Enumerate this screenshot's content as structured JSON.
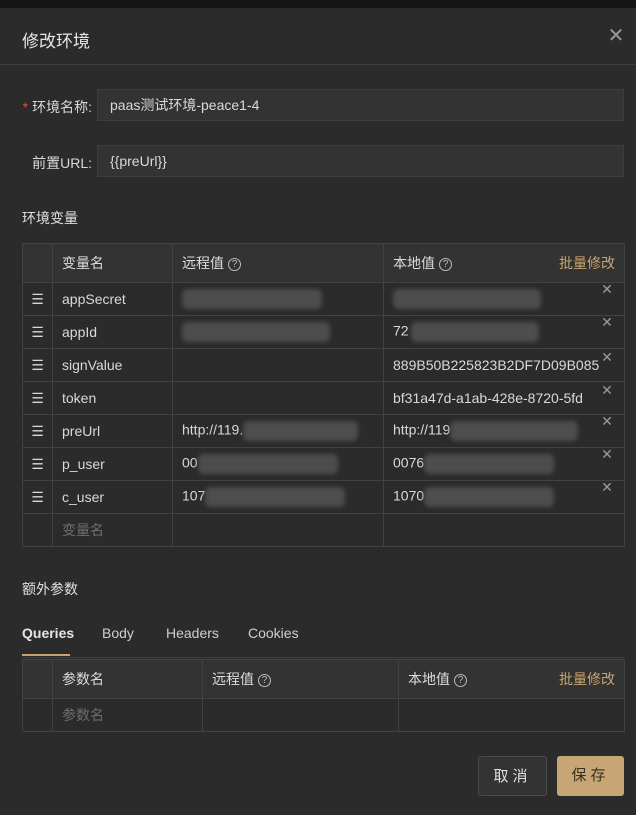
{
  "dialog": {
    "title": "修改环境",
    "close_glyph": "✕"
  },
  "form": {
    "env_name": {
      "required_mark": "*",
      "label": "环境名称:",
      "value": "paas测试环境-peace1-4"
    },
    "pre_url": {
      "label": "前置URL:",
      "value": "{{preUrl}}"
    }
  },
  "env_vars": {
    "section_title": "环境变量",
    "headers": {
      "name": "变量名",
      "remote": "远程值",
      "local": "本地值",
      "batch": "批量修改",
      "help_glyph": "?"
    },
    "rows": [
      {
        "name": "appSecret",
        "remote": "",
        "local": ""
      },
      {
        "name": "appId",
        "remote": "",
        "local": "72"
      },
      {
        "name": "signValue",
        "remote": "",
        "local": "889B50B225823B2DF7D09B085"
      },
      {
        "name": "token",
        "remote": "",
        "local": "bf31a47d-a1ab-428e-8720-5fd"
      },
      {
        "name": "preUrl",
        "remote": "http://119.",
        "local": "http://119"
      },
      {
        "name": "p_user",
        "remote": "00",
        "local": "0076"
      },
      {
        "name": "c_user",
        "remote": "107",
        "local": "1070"
      }
    ],
    "new_row_placeholder": "变量名",
    "drag_glyph": "☰",
    "delete_glyph": "✕"
  },
  "extra_params": {
    "section_title": "额外参数",
    "tabs": [
      "Queries",
      "Body",
      "Headers",
      "Cookies"
    ],
    "active_tab": "Queries",
    "headers": {
      "name": "参数名",
      "remote": "远程值",
      "local": "本地值",
      "batch": "批量修改"
    },
    "new_row_placeholder": "参数名"
  },
  "footer": {
    "cancel": "取消",
    "save": "保存"
  },
  "colors": {
    "background": "#2b2b2b",
    "accent": "#c8a46e",
    "save_button": "#c7a574",
    "required": "#d0563c"
  }
}
